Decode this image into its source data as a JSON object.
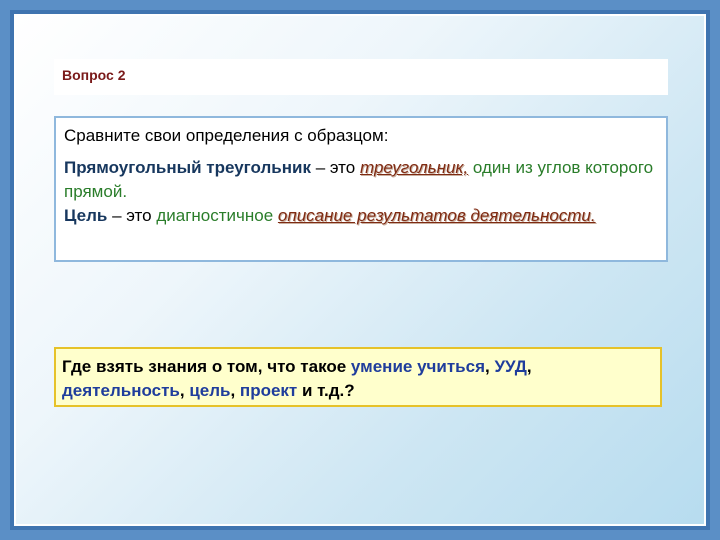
{
  "question_label": "Вопрос 2",
  "compare": {
    "intro": "Сравните свои определения с образцом:",
    "def1": {
      "term": "Прямоугольный треугольник",
      "dash": " – это ",
      "underlined": "треугольник,",
      "rest_green": " один из углов которого прямой."
    },
    "def2": {
      "term": "Цель",
      "dash": " – это ",
      "green": "диагностичное ",
      "underlined": "описание результатов деятельности."
    }
  },
  "question2": {
    "part1": "Где взять знания о том, что такое ",
    "blue1": "умение учиться",
    "part2": ", ",
    "blue2": "УУД",
    "part3": ", ",
    "blue3": "деятельность",
    "part4": ", ",
    "blue4": "цель",
    "part5": ", ",
    "blue5": "проект",
    "part6": " и т.д.?"
  },
  "colors": {
    "frame": "#5b8fc6",
    "term": "#17375e",
    "green": "#2a7d2a",
    "blue_highlight": "#1f3d9c",
    "box2_bg": "#ffffcc",
    "box2_border": "#e6c229"
  }
}
